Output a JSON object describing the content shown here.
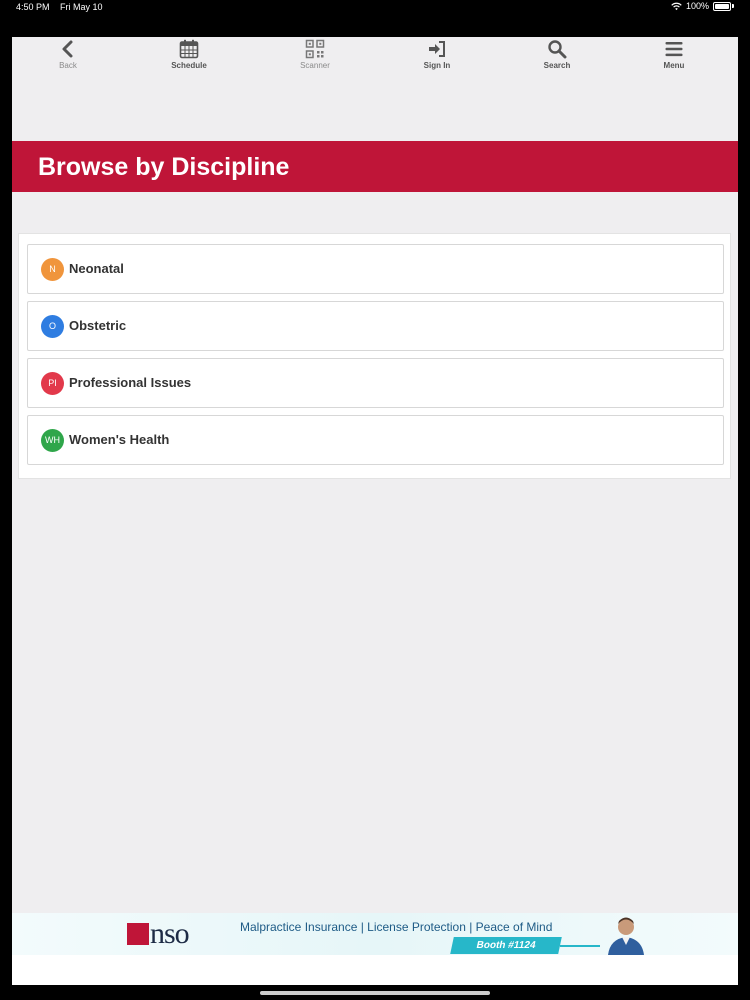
{
  "status_bar": {
    "time": "4:50 PM",
    "date": "Fri May 10",
    "battery": "100%"
  },
  "toolbar": {
    "back": "Back",
    "schedule": "Schedule",
    "scanner": "Scanner",
    "sign_in": "Sign In",
    "search": "Search",
    "menu": "Menu"
  },
  "page": {
    "title": "Browse by Discipline"
  },
  "disciplines": [
    {
      "abbr": "N",
      "label": "Neonatal",
      "color": "#f0953c"
    },
    {
      "abbr": "O",
      "label": "Obstetric",
      "color": "#2f7de1"
    },
    {
      "abbr": "PI",
      "label": "Professional Issues",
      "color": "#e2394b"
    },
    {
      "abbr": "WH",
      "label": "Women's Health",
      "color": "#2fa64a"
    }
  ],
  "ad": {
    "brand": "nso",
    "tagline": "Malpractice Insurance | License Protection | Peace of Mind",
    "booth": "Booth #1124"
  },
  "colors": {
    "banner": "#bf1538",
    "background": "#efeef0"
  }
}
